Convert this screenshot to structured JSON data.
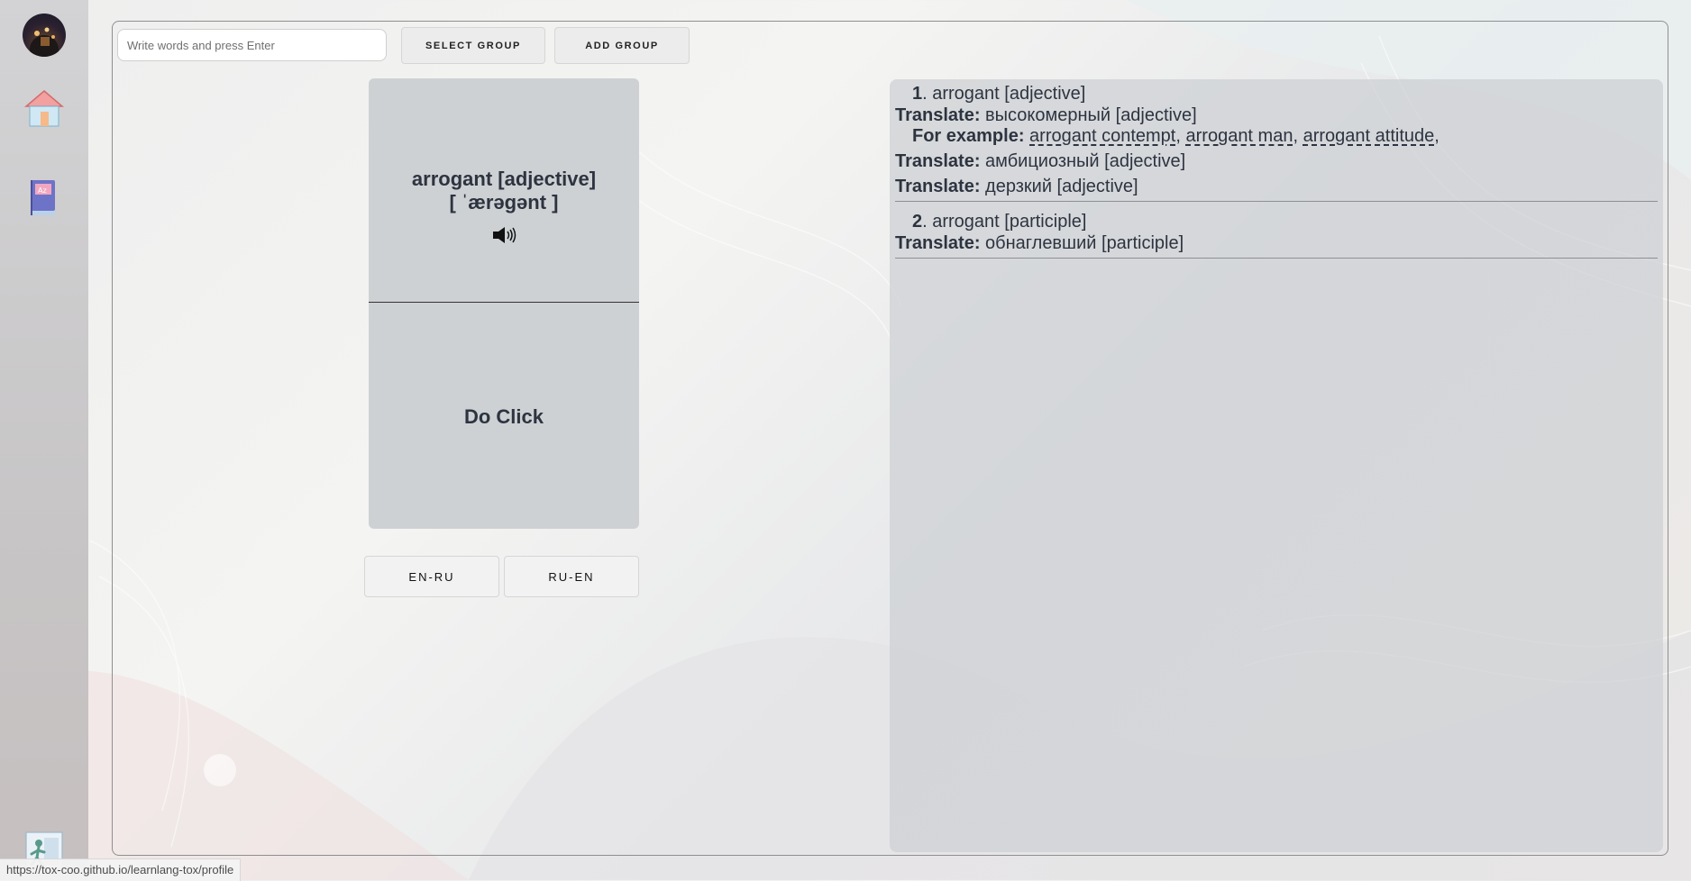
{
  "sidebar": {
    "avatar_icon": "user-avatar",
    "items": [
      {
        "icon": "home-icon"
      },
      {
        "icon": "dictionary-book-icon"
      }
    ],
    "logout_icon": "exit-door-icon"
  },
  "toolbar": {
    "search_placeholder": "Write words and press Enter",
    "select_group_label": "SELECT GROUP",
    "add_group_label": "ADD GROUP"
  },
  "flashcard": {
    "word": "arrogant [adjective]",
    "transcription": "[ ˈærəɡənt ]",
    "audio_icon": "speaker-icon",
    "back_prompt": "Do Click"
  },
  "direction": {
    "en_ru_label": "EN-RU",
    "ru_en_label": "RU-EN"
  },
  "definitions": {
    "entries": [
      {
        "number": "1",
        "headword": ". arrogant [adjective]",
        "translations": [
          {
            "label": "Translate:",
            "text": " высокомерный [adjective]"
          },
          {
            "label": "Translate:",
            "text": " амбициозный [adjective]"
          },
          {
            "label": "Translate:",
            "text": " дерзкий [adjective]"
          }
        ],
        "example_label": "For example:",
        "examples": [
          "arrogant contempt",
          "arrogant man",
          "arrogant attitude"
        ]
      },
      {
        "number": "2",
        "headword": ". arrogant [participle]",
        "translations": [
          {
            "label": "Translate:",
            "text": " обнаглевший [participle]"
          }
        ]
      }
    ]
  },
  "status_bar": {
    "url": "https://tox-coo.github.io/learnlang-tox/profile"
  },
  "colors": {
    "card_bg": "#ced1d4",
    "text": "#2d3440",
    "frame_border": "#8f8f8f"
  }
}
